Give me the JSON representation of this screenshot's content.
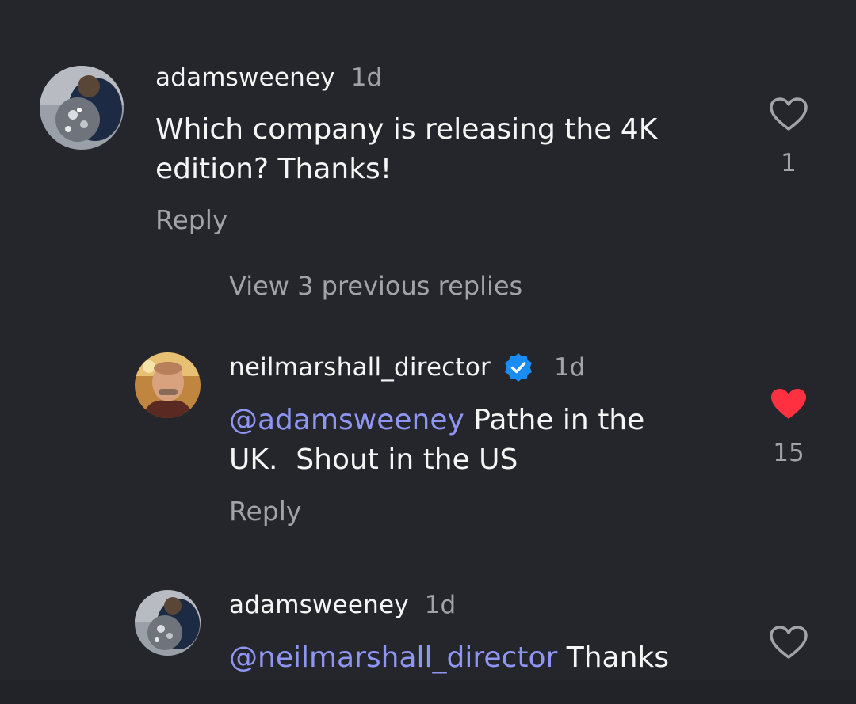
{
  "comments": [
    {
      "username": "adamsweeney",
      "time": "1d",
      "text": "Which company is releasing the 4K edition? Thanks!",
      "text_line1": "Which company is releasing the 4K",
      "text_line2": "edition? Thanks!",
      "reply_label": "Reply",
      "like_count": "1",
      "liked": false,
      "avatar_icon": "user-avatar-disco-ball"
    },
    {
      "username": "neilmarshall_director",
      "verified": true,
      "time": "1d",
      "mention": "@adamsweeney",
      "text_line1_rest": " Pathe in the",
      "text_line2": "UK.  Shout in the US",
      "reply_label": "Reply",
      "like_count": "15",
      "liked": true,
      "avatar_icon": "user-avatar-portrait"
    },
    {
      "username": "adamsweeney",
      "time": "1d",
      "mention": "@neilmarshall_director",
      "text_rest": " Thanks",
      "liked": false,
      "avatar_icon": "user-avatar-disco-ball"
    }
  ],
  "view_previous_replies": "View 3 previous replies",
  "colors": {
    "background": "#25262b",
    "mention": "#8f95f2",
    "like_active": "#ff3040",
    "muted_text": "#a0a3a8"
  }
}
